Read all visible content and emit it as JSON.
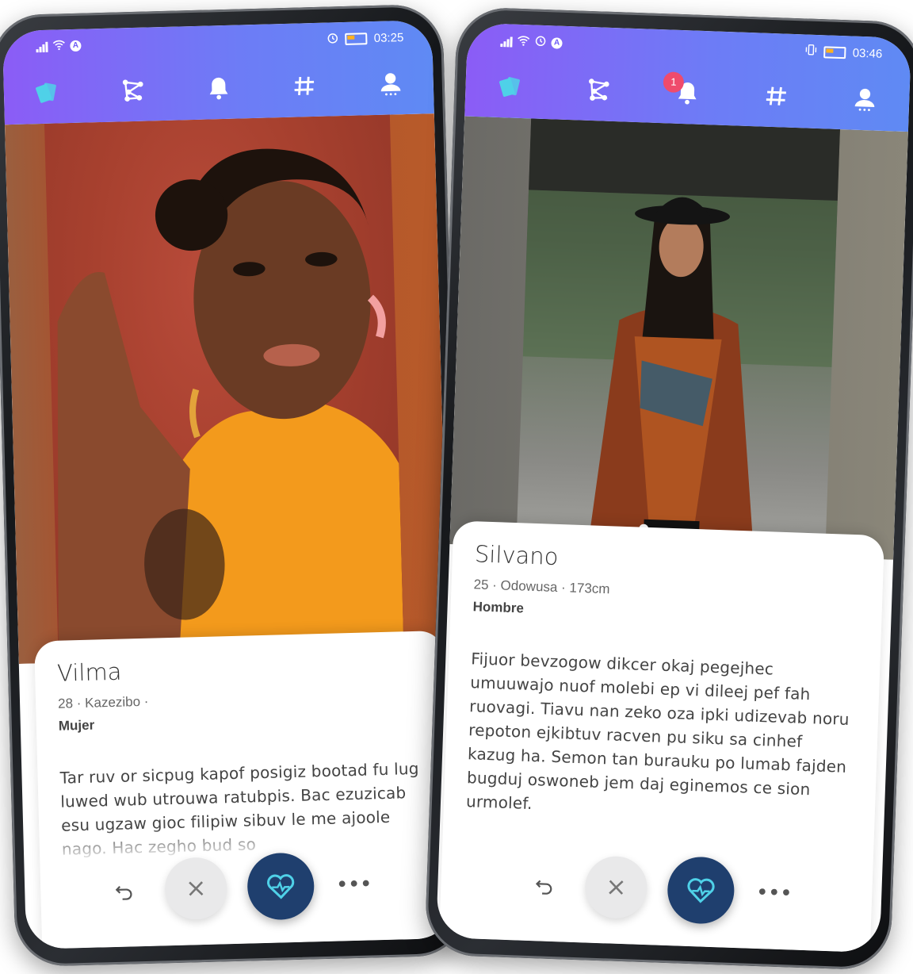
{
  "left": {
    "status": {
      "time": "03:25"
    },
    "profile": {
      "name": "Vilma",
      "meta": "28 · Kazezibo ·",
      "gender": "Mujer",
      "bio": "Tar ruv or sicpug kapof posigiz bootad fu lug luwed wub utrouwa ratubpis. Bac ezuzicab esu ugzaw gioc filipiw sibuv le me ajoole nago. Hac zegho bud so",
      "photo_id": "1141301654"
    }
  },
  "right": {
    "status": {
      "time": "03:46"
    },
    "notifications_badge": "1",
    "profile": {
      "name": "Silvano",
      "meta": "25 · Odowusa · 173cm",
      "gender": "Hombre",
      "bio": "Fijuor bevzogow dikcer okaj pegejhec umuuwajo nuof molebi ep vi dileej pef fah ruovagi. Tiavu nan zeko oza ipki udizevab noru repoton ejkibtuv racven pu siku sa cinhef kazug ha. Semon tan burauku po lumab fajden bugduj oswoneb jem daj eginemos ce sion urmolef."
    }
  },
  "actions": {
    "more_label": "•••"
  },
  "colors": {
    "accent": "#8b5cf6",
    "like_button": "#1f3f6e",
    "badge": "#ef4b6c",
    "active_indicator": "#4fd1e8"
  },
  "icons": [
    "cards-icon",
    "graph-icon",
    "bell-icon",
    "hashtag-icon",
    "profile-icon",
    "undo-icon",
    "close-icon",
    "heart-icon",
    "more-icon"
  ]
}
